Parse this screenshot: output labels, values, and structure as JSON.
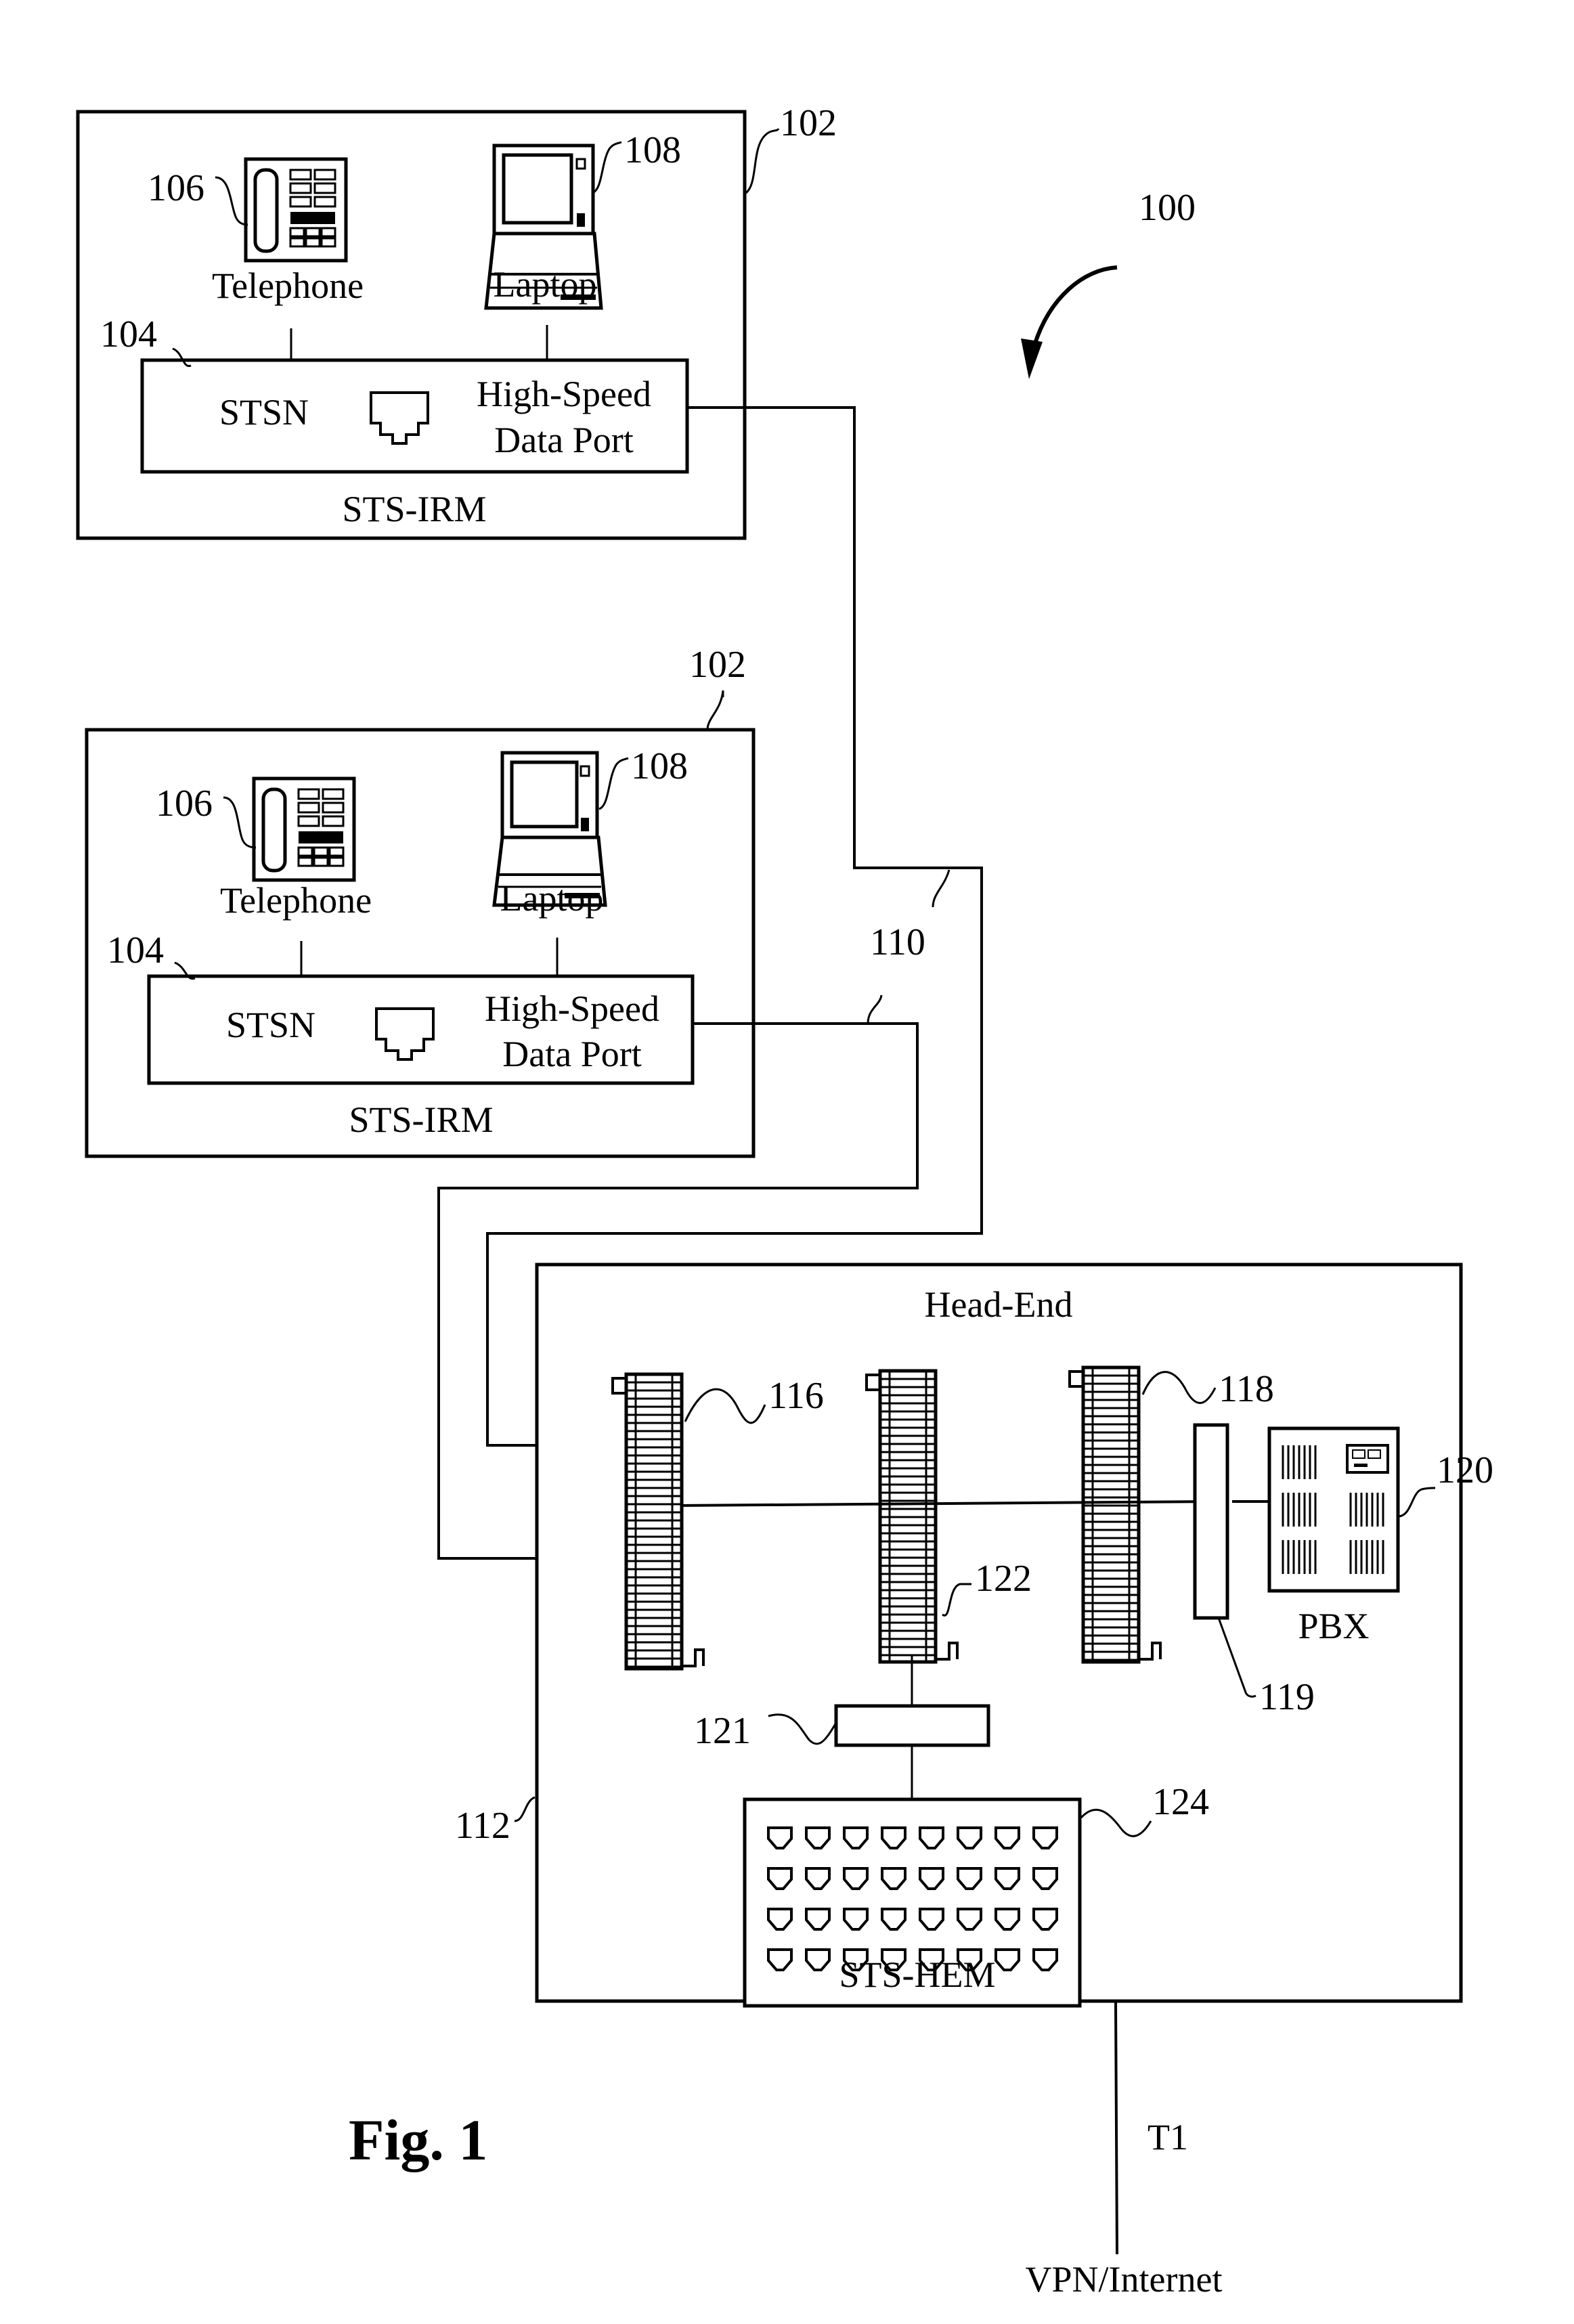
{
  "figure": {
    "caption": "Fig. 1",
    "system_ref": "100",
    "colors": {
      "ink": "#000000",
      "background": "#ffffff"
    }
  },
  "rooms": [
    {
      "ref": "102",
      "module_label": "STS-IRM",
      "telephone": {
        "ref": "106",
        "label": "Telephone"
      },
      "laptop": {
        "ref": "108",
        "label": "Laptop"
      },
      "node": {
        "ref": "104",
        "label": "STSN",
        "port_label_line1": "High-Speed",
        "port_label_line2": "Data Port"
      }
    },
    {
      "ref": "102",
      "module_label": "STS-IRM",
      "telephone": {
        "ref": "106",
        "label": "Telephone"
      },
      "laptop": {
        "ref": "108",
        "label": "Laptop"
      },
      "node": {
        "ref": "104",
        "label": "STSN",
        "port_label_line1": "High-Speed",
        "port_label_line2": "Data Port"
      }
    }
  ],
  "cabling": {
    "ref": "110"
  },
  "head_end": {
    "title": "Head-End",
    "ref": "112",
    "punch_blocks": [
      {
        "ref": "116"
      },
      {
        "ref": "122"
      },
      {
        "ref": "118"
      }
    ],
    "connector_119": {
      "ref": "119"
    },
    "connector_121": {
      "ref": "121"
    },
    "pbx": {
      "ref": "120",
      "label": "PBX"
    },
    "hem": {
      "ref": "124",
      "label": "STS-HEM",
      "port_rows": 4,
      "port_cols": 8
    }
  },
  "uplink": {
    "label": "T1",
    "destination": "VPN/Internet"
  }
}
